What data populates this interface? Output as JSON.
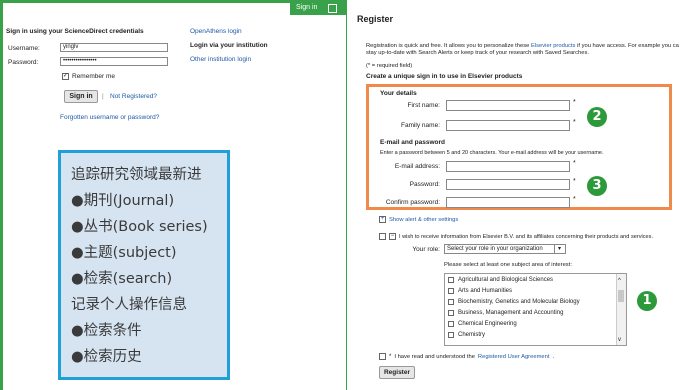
{
  "left_panel": {
    "topbar": {
      "label": "Sign in"
    },
    "credentials_title": "Sign in using your ScienceDirect credentials",
    "username_label": "Username:",
    "username_value": "yinglv",
    "password_label": "Password:",
    "password_value": "••••••••••••••••",
    "remember_me": "Remember me",
    "signin_button": "Sign in",
    "separator": "|",
    "not_registered": "Not Registered?",
    "forgotten": "Forgotten username or password?",
    "openathens": "OpenAthens login",
    "institution_title": "Login via your institution",
    "other_institution": "Other institution login",
    "features": [
      "追踪研究领域最新进",
      "●期刊(Journal)",
      "●丛书(Book series)",
      "●主题(subject)",
      "●检索(search)",
      "记录个人操作信息",
      "●检索条件",
      "●检索历史"
    ]
  },
  "register": {
    "title": "Register",
    "intro_1": "Registration is quick and free. It allows you to personalize these ",
    "intro_link": "Elsevier products",
    "intro_2": " if you have access. For example you ca",
    "intro_line2": "stay up-to-date with Search Alerts or keep track of your research with Saved Searches.",
    "required_note": "(* = required field)",
    "create_heading": "Create a unique sign in to use in Elsevier products",
    "your_details": "Your details",
    "first_name_label": "First name:",
    "family_name_label": "Family name:",
    "email_section": "E-mail and password",
    "password_hint": "Enter a password between 5 and 20 characters. Your e-mail address will be your username.",
    "email_label": "E-mail address:",
    "password_label": "Password:",
    "confirm_label": "Confirm password:",
    "asterisk": "*",
    "show_alert": "Show alert & other settings",
    "receive_info": "I wish to receive information from Elsevier B.V. and its affiliates concerning their products and services.",
    "role_label": "Your role:",
    "role_value": "Select your role in your organization",
    "subject_prompt": "Please select at least one subject area of interest:",
    "subjects": [
      "Agricultural and Biological Sciences",
      "Arts and Humanities",
      "Biochemistry, Genetics and Molecular Biology",
      "Business, Management and Accounting",
      "Chemical Engineering",
      "Chemistry"
    ],
    "agreement_prefix": "I have read and understood the ",
    "agreement_link": "Registered User Agreement",
    "agreement_suffix": ".",
    "register_button": "Register"
  },
  "badges": {
    "one": "1",
    "two": "2",
    "three": "3"
  },
  "colors": {
    "green": "#3aa14b",
    "orange": "#f08a4b",
    "blue": "#1fa0d8",
    "badge": "#2c9a3a",
    "link": "#1f5aa6"
  }
}
